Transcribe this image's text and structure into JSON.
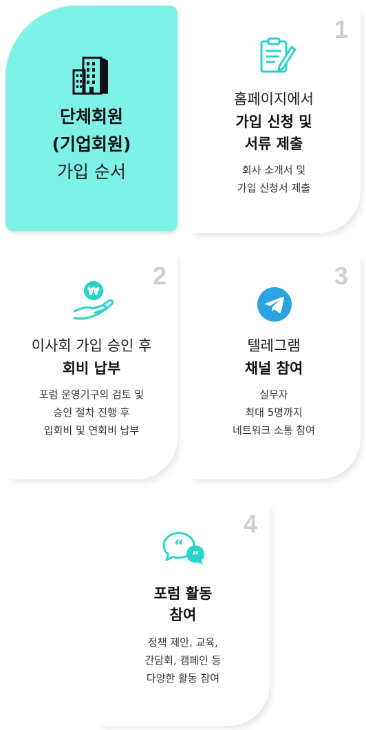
{
  "hero": {
    "title_line1": "단체회원",
    "title_line2": "(기업회원)",
    "subtitle": "가입 순서"
  },
  "steps": [
    {
      "number": "1",
      "icon": "document-pen-icon",
      "line1": "홈페이지에서",
      "bold1": "가입 신청 및",
      "bold2": "서류 제출",
      "desc": [
        "회사 소개서 및",
        "가입 신청서 제출"
      ]
    },
    {
      "number": "2",
      "icon": "hand-coin-icon",
      "line1": "이사회 가입 승인 후",
      "bold1": "회비 납부",
      "desc": [
        "포럼 운영기구의 검토 및",
        "승인 절차 진행 후",
        "입회비 및 연회비 납부"
      ]
    },
    {
      "number": "3",
      "icon": "telegram-icon",
      "line1": "텔레그램",
      "bold1": "채널 참여",
      "desc": [
        "실무자",
        "최대 5명까지",
        "네트워크 소통 참여"
      ]
    },
    {
      "number": "4",
      "icon": "chat-bubbles-icon",
      "bold1": "포럼 활동",
      "bold2": "참여",
      "desc": [
        "정책 제안, 교육,",
        "간담회, 캠페인 등",
        "다양한 활동 참여"
      ]
    }
  ],
  "colors": {
    "accent": "#7ef2e7",
    "icon_teal": "#2ad3c8",
    "telegram": "#2aa3e0",
    "number_gray": "#cfcfcf"
  }
}
